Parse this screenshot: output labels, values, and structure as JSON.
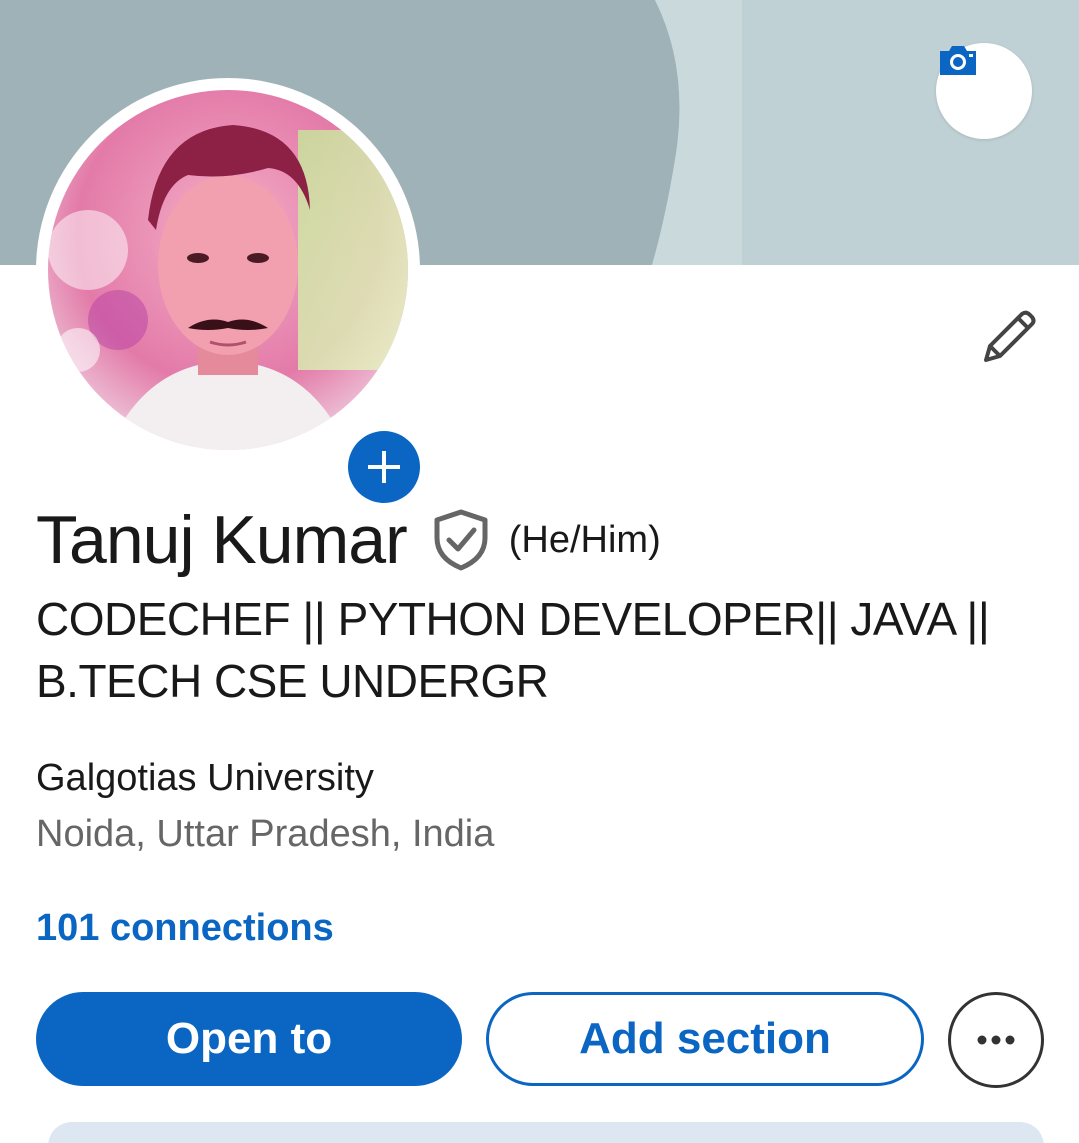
{
  "profile": {
    "name": "Tanuj Kumar",
    "pronouns": "(He/Him)",
    "headline": "CODECHEF || PYTHON DEVELOPER|| JAVA || B.TECH CSE UNDERGR",
    "school": "Galgotias University",
    "location": "Noida, Uttar Pradesh, India",
    "connections": "101 connections"
  },
  "actions": {
    "open_to_label": "Open to",
    "add_section_label": "Add section",
    "more_icon": "more-horizontal-icon"
  },
  "icons": {
    "cover_camera": "camera-icon",
    "avatar_add": "plus-icon",
    "edit": "pencil-icon",
    "verified": "shield-check-icon"
  },
  "colors": {
    "brand_blue": "#0a66c2",
    "text_primary": "#191919",
    "text_secondary": "#666666",
    "cover_dark": "#9fb2b7",
    "cover_light": "#bfd1d4"
  }
}
